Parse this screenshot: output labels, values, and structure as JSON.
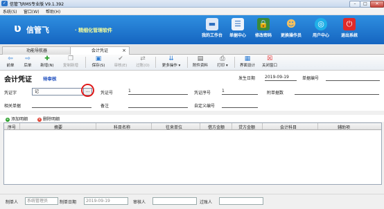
{
  "window": {
    "title": "信管飞RMS专业版 V9.1.392",
    "controls": {
      "minimize": "–",
      "maximize": "□",
      "close": "✕"
    }
  },
  "menu": [
    "系统(S)",
    "窗口(W)",
    "帮助(H)"
  ],
  "banner": {
    "brand": "信管飞",
    "slogan": "精细化管理软件",
    "nav": [
      {
        "label": "我的工作台",
        "icon": "monitor-icon",
        "glyph": "▬",
        "color": "#3f7fd0"
      },
      {
        "label": "单据中心",
        "icon": "document-list-icon",
        "glyph": "☰",
        "color": "#3f7fd0"
      },
      {
        "label": "修改密码",
        "icon": "key-lock-icon",
        "glyph": "🔑",
        "color": "#d8a020"
      },
      {
        "label": "更换操作员",
        "icon": "user-icon",
        "glyph": "☻",
        "color": "#e08a20"
      },
      {
        "label": "用户中心",
        "icon": "globe-icon",
        "glyph": "◎",
        "color": "#18a0d8"
      },
      {
        "label": "退出系统",
        "icon": "power-icon",
        "glyph": "⏻",
        "color": "#e02020"
      }
    ]
  },
  "tabs": [
    {
      "label": "功能导航器"
    },
    {
      "label": "会计凭证",
      "close": "×"
    }
  ],
  "toolbar": {
    "items": [
      {
        "label": "前单",
        "glyph": "◀",
        "icon": "prev-arrow-icon",
        "color": "#2b7bd3",
        "enabled": true
      },
      {
        "label": "后单",
        "glyph": "▶",
        "icon": "next-arrow-icon",
        "color": "#2b7bd3",
        "enabled": true
      },
      {
        "label": "新增(N)",
        "glyph": "✚",
        "icon": "add-icon",
        "color": "#2aa02a",
        "enabled": true
      },
      {
        "label": "复制新增",
        "glyph": "❐",
        "icon": "copy-icon",
        "color": "#999",
        "enabled": false
      },
      {
        "label": "保存(S)",
        "glyph": "💾",
        "icon": "save-icon",
        "color": "#2b7bd3",
        "enabled": true
      },
      {
        "label": "审核(E)",
        "glyph": "✔",
        "icon": "audit-icon",
        "color": "#999",
        "enabled": false
      },
      {
        "label": "过账(O)",
        "glyph": "⇄",
        "icon": "post-icon",
        "color": "#999",
        "enabled": false
      },
      {
        "label": "更多操作",
        "glyph": "≡",
        "icon": "more-actions-icon",
        "color": "#2b7bd3",
        "enabled": true
      },
      {
        "label": "附件资料",
        "glyph": "📎",
        "icon": "attachment-icon",
        "color": "#555",
        "enabled": true
      },
      {
        "label": "打印",
        "glyph": "🖶",
        "icon": "print-icon",
        "color": "#555",
        "enabled": true
      },
      {
        "label": "界面设计",
        "glyph": "▦",
        "icon": "layout-design-icon",
        "color": "#2b7bd3",
        "enabled": true
      },
      {
        "label": "关闭窗口",
        "glyph": "✖",
        "icon": "close-window-icon",
        "color": "#e02020",
        "enabled": true
      }
    ]
  },
  "voucher": {
    "title": "会计凭证",
    "status": "待审核",
    "date_label": "发生日期",
    "date_value": "2019-09-19",
    "number_label": "单据编号",
    "number_value": ""
  },
  "form": {
    "voucher_word_label": "凭证字",
    "voucher_word_value": "记",
    "ellipsis": "...",
    "voucher_no_label": "凭证号",
    "voucher_no_value": "1",
    "voucher_seq_label": "凭证序号",
    "voucher_seq_value": "1",
    "attachments_label": "附单据数",
    "attachments_value": "",
    "related_label": "相关单据",
    "related_value": "",
    "note_label": "备注",
    "note_value": "",
    "custom_no_label": "自定义编号",
    "custom_no_value": ""
  },
  "details": {
    "add_label": "添加明细",
    "delete_label": "删除明细",
    "columns": [
      "序号",
      "摘要",
      "科目名称",
      "往来单位",
      "借方金额",
      "贷方金额",
      "会计科目",
      "辅助项"
    ]
  },
  "footer": {
    "maker_label": "制单人",
    "maker_value": "系统管理员",
    "make_date_label": "制单日期",
    "make_date_value": "2019-09-19",
    "auditor_label": "审核人",
    "auditor_value": "",
    "poster_label": "过账人",
    "poster_value": ""
  }
}
